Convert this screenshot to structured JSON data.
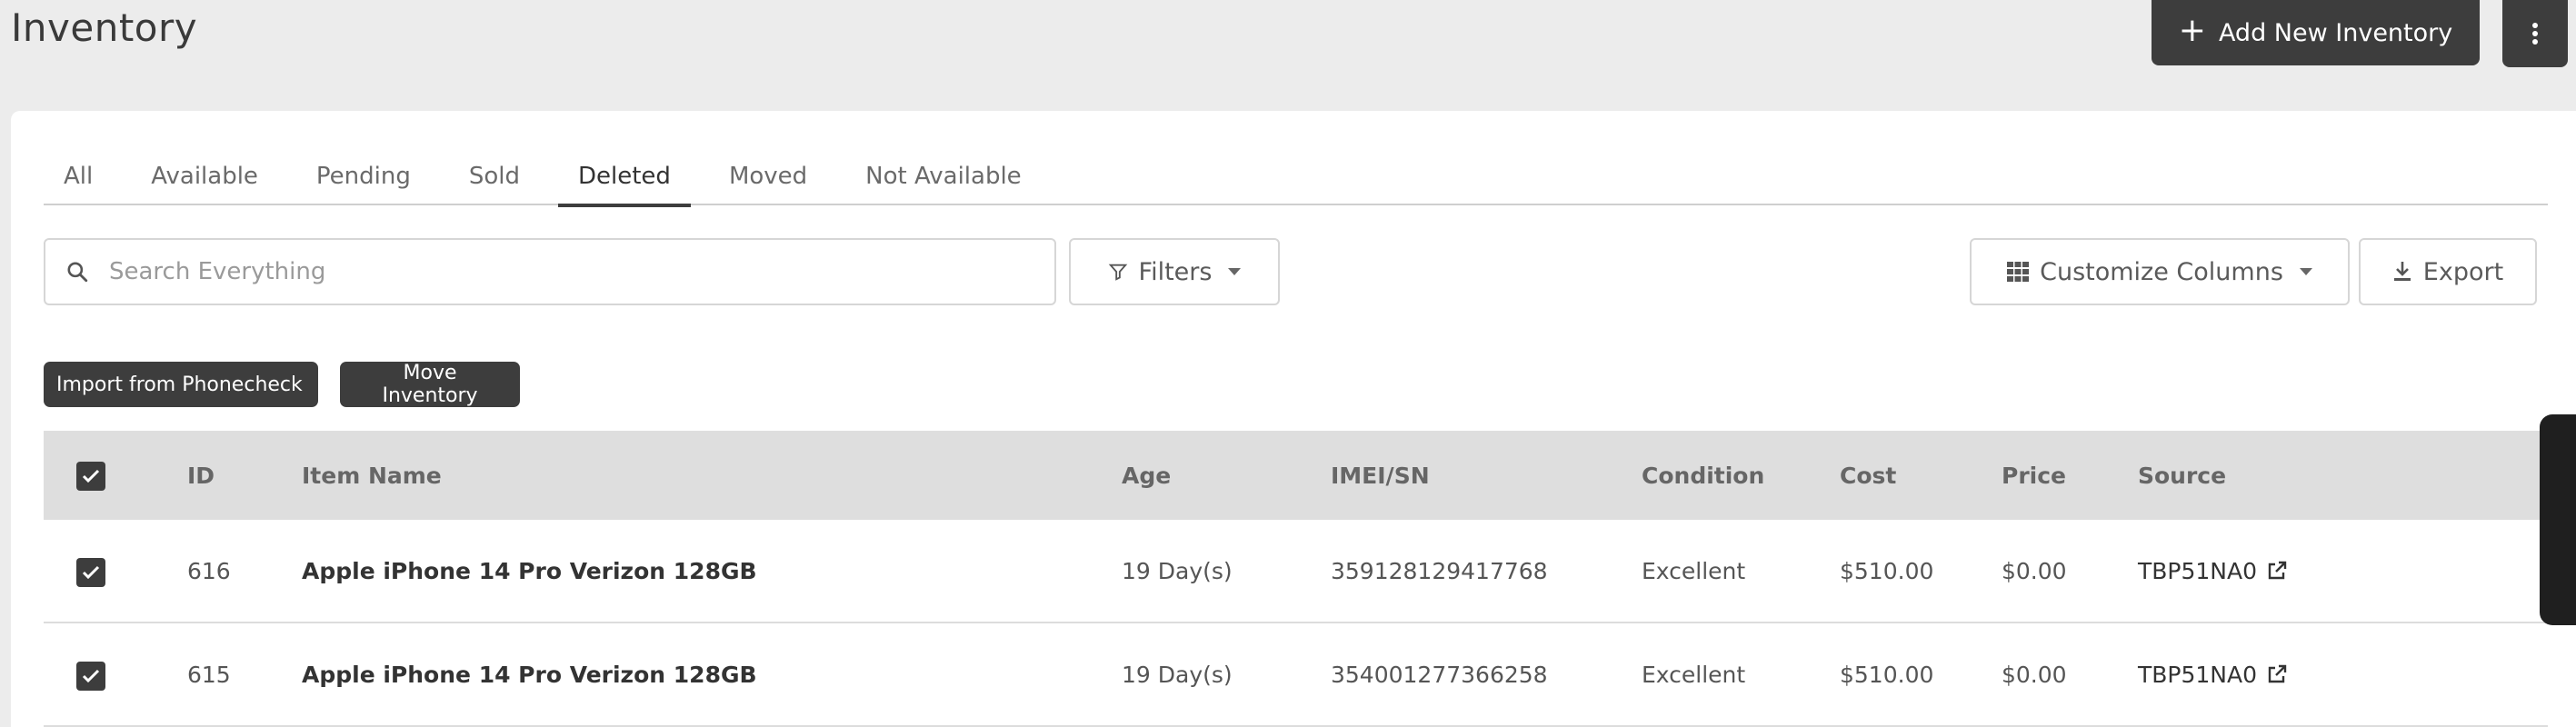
{
  "header": {
    "title": "Inventory",
    "add_button_label": "Add New Inventory",
    "more_icon": "vertical-dots-icon"
  },
  "tabs": [
    {
      "label": "All",
      "active": false
    },
    {
      "label": "Available",
      "active": false
    },
    {
      "label": "Pending",
      "active": false
    },
    {
      "label": "Sold",
      "active": false
    },
    {
      "label": "Deleted",
      "active": true
    },
    {
      "label": "Moved",
      "active": false
    },
    {
      "label": "Not Available",
      "active": false
    }
  ],
  "search": {
    "placeholder": "Search Everything",
    "value": ""
  },
  "toolbar": {
    "filters_label": "Filters",
    "customize_columns_label": "Customize Columns",
    "export_label": "Export",
    "import_label": "Import from Phonecheck",
    "move_label": "Move Inventory"
  },
  "table": {
    "columns": [
      "ID",
      "Item Name",
      "Age",
      "IMEI/SN",
      "Condition",
      "Cost",
      "Price",
      "Source"
    ],
    "header_checked": true,
    "rows": [
      {
        "checked": true,
        "id": "616",
        "item_name": "Apple iPhone 14 Pro Verizon 128GB",
        "age": "19 Day(s)",
        "imei": "359128129417768",
        "condition": "Excellent",
        "cost": "$510.00",
        "price": "$0.00",
        "source": "TBP51NA0"
      },
      {
        "checked": true,
        "id": "615",
        "item_name": "Apple iPhone 14 Pro Verizon 128GB",
        "age": "19 Day(s)",
        "imei": "354001277366258",
        "condition": "Excellent",
        "cost": "$510.00",
        "price": "$0.00",
        "source": "TBP51NA0"
      }
    ]
  },
  "colors": {
    "dark_button": "#3d3d3d",
    "background": "#ececec",
    "header_row": "#dedede"
  }
}
